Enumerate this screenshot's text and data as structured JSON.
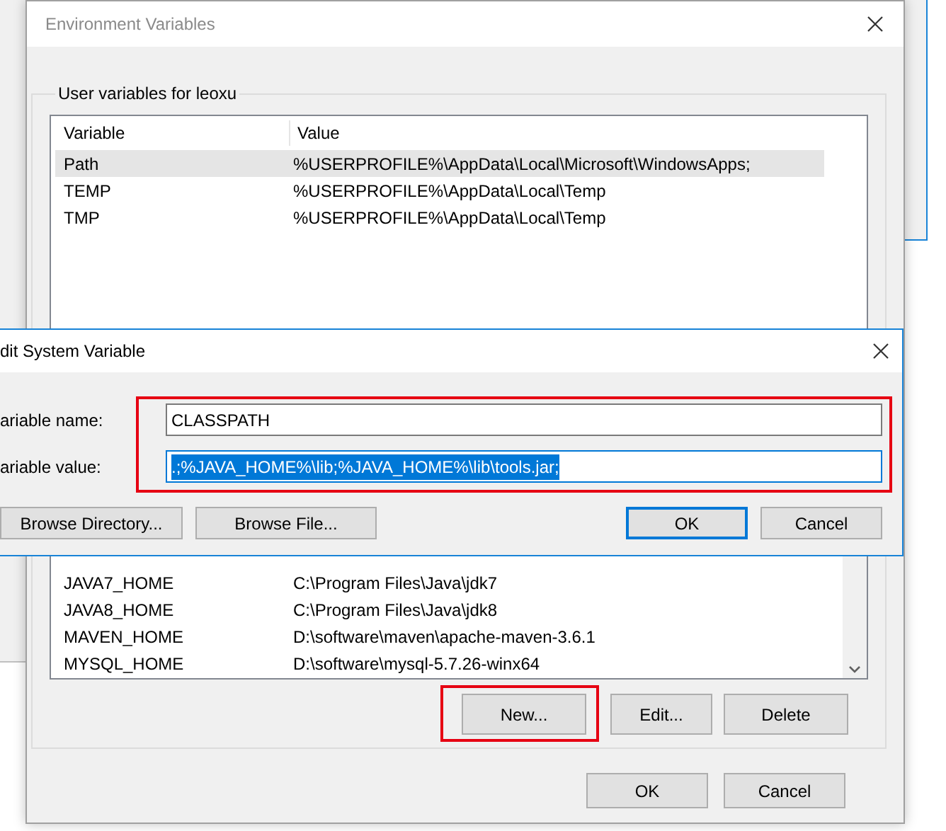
{
  "env_window": {
    "title": "Environment Variables",
    "user_group": {
      "legend": "User variables for leoxu",
      "columns": [
        "Variable",
        "Value"
      ],
      "rows": [
        {
          "variable": "Path",
          "value": "%USERPROFILE%\\AppData\\Local\\Microsoft\\WindowsApps;",
          "selected": true
        },
        {
          "variable": "TEMP",
          "value": "%USERPROFILE%\\AppData\\Local\\Temp",
          "selected": false
        },
        {
          "variable": "TMP",
          "value": "%USERPROFILE%\\AppData\\Local\\Temp",
          "selected": false
        }
      ]
    },
    "system_group": {
      "rows": [
        {
          "variable": "JAVA7_HOME",
          "value": "C:\\Program Files\\Java\\jdk7",
          "selected": false
        },
        {
          "variable": "JAVA8_HOME",
          "value": "C:\\Program Files\\Java\\jdk8",
          "selected": false
        },
        {
          "variable": "MAVEN_HOME",
          "value": "D:\\software\\maven\\apache-maven-3.6.1",
          "selected": false
        },
        {
          "variable": "MYSQL_HOME",
          "value": "D:\\software\\mysql-5.7.26-winx64",
          "selected": false
        }
      ],
      "new_button_highlighted": true,
      "buttons": [
        "New...",
        "Edit...",
        "Delete"
      ]
    },
    "buttons": [
      "OK",
      "Cancel"
    ]
  },
  "edit_dialog": {
    "title": "dit System Variable",
    "fields_highlighted": true,
    "fields": [
      {
        "label": "ariable name:",
        "value": "CLASSPATH",
        "text_selected": false
      },
      {
        "label": "ariable value:",
        "value": ".;%JAVA_HOME%\\lib;%JAVA_HOME%\\lib\\tools.jar;",
        "text_selected": true
      }
    ],
    "buttons": [
      {
        "label": "Browse Directory...",
        "default": false
      },
      {
        "label": "Browse File...",
        "default": false
      },
      {
        "label": "OK",
        "default": true
      },
      {
        "label": "Cancel",
        "default": false
      }
    ]
  }
}
